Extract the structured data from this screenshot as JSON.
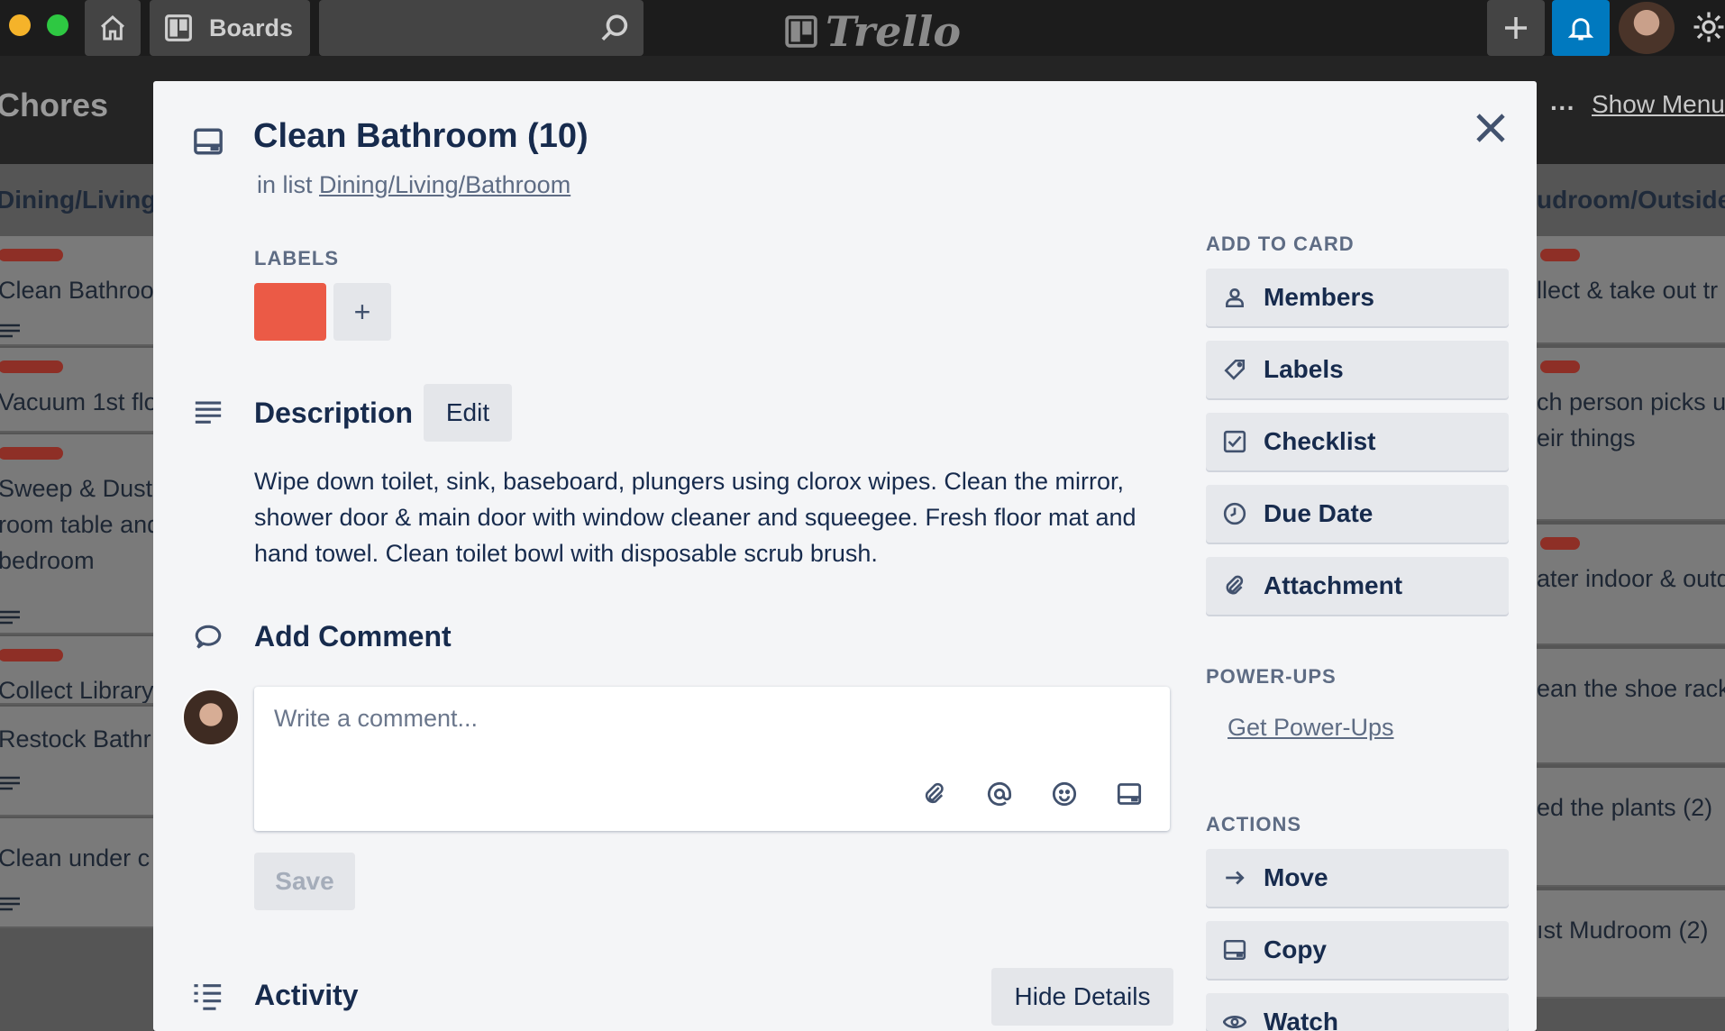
{
  "header": {
    "boards_label": "Boards",
    "logo_text": "Trello"
  },
  "board": {
    "title": "Chores",
    "more_label": "···",
    "show_menu_label": "Show Menu",
    "left_list": {
      "title": "Dining/Living",
      "cards": [
        "Clean Bathroo",
        "Vacuum 1st flo",
        "Sweep & Dust\nroom table and\nbedroom",
        "Collect Library",
        "Restock Bathr",
        "Clean under c"
      ]
    },
    "right_list": {
      "title": "udroom/Outside",
      "cards": [
        "llect & take out tr",
        "ch person picks u\neir things",
        "ater indoor & outd",
        "ean the shoe rack",
        "ed the plants (2)",
        "ıst Mudroom (2)"
      ]
    }
  },
  "card": {
    "title": "Clean Bathroom (10)",
    "in_list_prefix": "in list",
    "list_name": "Dining/Living/Bathroom",
    "labels_heading": "Labels",
    "label_color": "#eb5a46",
    "add_label_symbol": "+",
    "description_heading": "Description",
    "edit_label": "Edit",
    "description": "Wipe down toilet, sink, baseboard, plungers using clorox wipes. Clean the mirror, shower door & main door with window cleaner and squeegee. Fresh floor mat and hand towel. Clean toilet bowl with disposable scrub brush.",
    "add_comment_heading": "Add Comment",
    "comment_placeholder": "Write a comment...",
    "comment_value": "",
    "save_label": "Save",
    "activity_heading": "Activity",
    "hide_details_label": "Hide Details"
  },
  "sidebar": {
    "add_to_card_heading": "Add to Card",
    "add_to_card": [
      {
        "label": "Members",
        "icon": "person-icon"
      },
      {
        "label": "Labels",
        "icon": "tag-icon"
      },
      {
        "label": "Checklist",
        "icon": "checkbox-icon"
      },
      {
        "label": "Due Date",
        "icon": "clock-icon"
      },
      {
        "label": "Attachment",
        "icon": "paperclip-icon"
      }
    ],
    "power_ups_heading": "Power-Ups",
    "get_power_ups_label": "Get Power-Ups",
    "actions_heading": "Actions",
    "actions": [
      {
        "label": "Move",
        "icon": "arrow-right-icon"
      },
      {
        "label": "Copy",
        "icon": "card-icon"
      },
      {
        "label": "Watch",
        "icon": "eye-icon"
      }
    ]
  },
  "colors": {
    "accent_blue": "#0079bf",
    "label_red": "#eb5a46",
    "modal_bg": "#f4f5f7"
  }
}
